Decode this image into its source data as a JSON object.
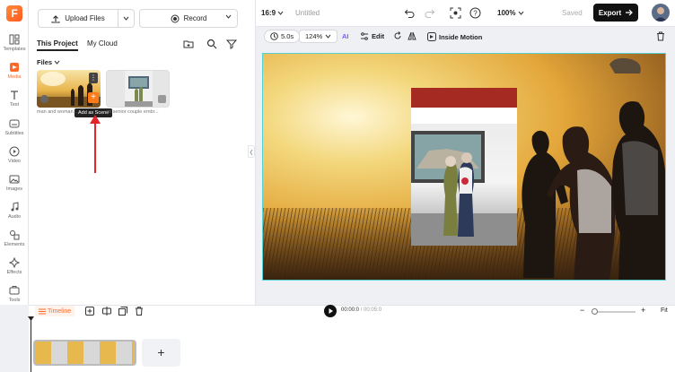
{
  "sidebar": {
    "items": [
      {
        "label": "Templates",
        "icon": "templates-icon"
      },
      {
        "label": "Media",
        "icon": "media-icon"
      },
      {
        "label": "Text",
        "icon": "text-icon"
      },
      {
        "label": "Subtitles",
        "icon": "subtitles-icon"
      },
      {
        "label": "Video",
        "icon": "video-icon"
      },
      {
        "label": "Images",
        "icon": "images-icon"
      },
      {
        "label": "Audio",
        "icon": "audio-icon"
      },
      {
        "label": "Elements",
        "icon": "elements-icon"
      },
      {
        "label": "Effects",
        "icon": "effects-icon"
      },
      {
        "label": "Tools",
        "icon": "tools-icon"
      }
    ],
    "active": "Media",
    "accent": "#ff6a2a"
  },
  "media_panel": {
    "upload_label": "Upload Files",
    "record_label": "Record",
    "tabs": [
      {
        "label": "This Project"
      },
      {
        "label": "My Cloud"
      }
    ],
    "files_label": "Files",
    "thumbnails": [
      {
        "caption": "man and woman..."
      },
      {
        "caption": "an senior couple embr..."
      }
    ],
    "tooltip": "Add as Scene"
  },
  "topbar": {
    "ratio": "16:9",
    "title": "Untitled",
    "zoom": "100%",
    "saved": "Saved",
    "export_label": "Export"
  },
  "toolbar": {
    "duration": "5.0s",
    "scale": "124%",
    "ai_label": "AI",
    "edit_label": "Edit",
    "inside_motion_label": "Inside Motion"
  },
  "timeline": {
    "label": "Timeline",
    "current_time": "00:00:0",
    "total_time": "00:05:0",
    "fit_label": "Fit",
    "add_label": "+",
    "minus_label": "−",
    "plus_label": "+"
  },
  "colors": {
    "canvas_border": "#53d2d6",
    "arrow": "#e1252a",
    "export_bg": "#111111"
  }
}
